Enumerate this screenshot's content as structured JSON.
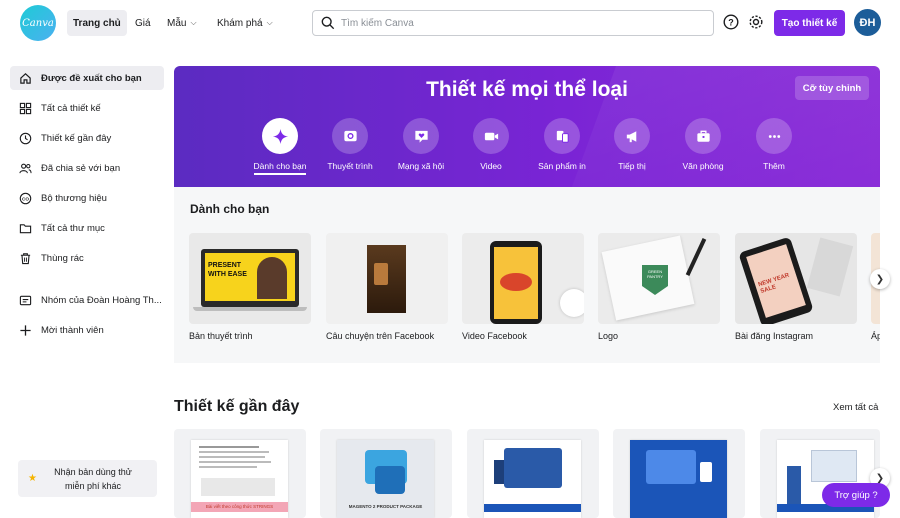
{
  "app": {
    "logo_text": "Canva"
  },
  "topnav": {
    "home": "Trang chủ",
    "pricing": "Giá",
    "templates": "Mẫu",
    "discover": "Khám phá"
  },
  "search": {
    "placeholder": "Tìm kiếm Canva"
  },
  "header": {
    "create_label": "Tạo thiết kế",
    "avatar_initials": "ĐH",
    "brand_color": "#7d2ae8"
  },
  "sidebar": {
    "items": [
      {
        "label": "Được đề xuất cho bạn",
        "icon": "home-icon"
      },
      {
        "label": "Tất cả thiết kế",
        "icon": "grid-icon"
      },
      {
        "label": "Thiết kế gần đây",
        "icon": "clock-icon"
      },
      {
        "label": "Đã chia sẻ với bạn",
        "icon": "people-icon"
      },
      {
        "label": "Bộ thương hiệu",
        "icon": "brand-icon"
      },
      {
        "label": "Tất cả thư mục",
        "icon": "folder-icon"
      },
      {
        "label": "Thùng rác",
        "icon": "trash-icon"
      }
    ],
    "team": "Nhóm của Đoàn Hoàng Th...",
    "invite": "Mời thành viên",
    "trial": "Nhận bản dùng thử miễn phí khác"
  },
  "hero": {
    "title": "Thiết kế mọi thể loại",
    "custom_size": "Cỡ tùy chỉnh",
    "categories": [
      {
        "label": "Dành cho bạn",
        "icon": "sparkle-icon"
      },
      {
        "label": "Thuyết trình",
        "icon": "presentation-icon"
      },
      {
        "label": "Mạng xã hội",
        "icon": "heart-chat-icon"
      },
      {
        "label": "Video",
        "icon": "video-icon"
      },
      {
        "label": "Sản phẩm in",
        "icon": "print-icon"
      },
      {
        "label": "Tiếp thị",
        "icon": "megaphone-icon"
      },
      {
        "label": "Văn phòng",
        "icon": "briefcase-icon"
      },
      {
        "label": "Thêm",
        "icon": "more-icon"
      }
    ]
  },
  "foryou": {
    "title": "Dành cho bạn",
    "cards": [
      {
        "label": "Bản thuyết trình",
        "thumb_text": "PRESENT WITH EASE"
      },
      {
        "label": "Câu chuyện trên Facebook",
        "thumb_text": ""
      },
      {
        "label": "Video Facebook",
        "thumb_text": ""
      },
      {
        "label": "Logo",
        "thumb_text": "GREEN PANTRY"
      },
      {
        "label": "Bài đăng Instagram",
        "thumb_text": "NEW YEAR SALE"
      },
      {
        "label": "Áp",
        "thumb_text": ""
      }
    ]
  },
  "recent": {
    "title": "Thiết kế gần đây",
    "see_all": "Xem tất cả",
    "cards": [
      {
        "caption": "Bài viết theo công thức STRINGS"
      },
      {
        "caption": "MAGENTO 2 PRODUCT PACKAGE"
      },
      {
        "caption": ""
      },
      {
        "caption": ""
      },
      {
        "caption": ""
      }
    ]
  },
  "help": {
    "label": "Trợ giúp ?"
  }
}
